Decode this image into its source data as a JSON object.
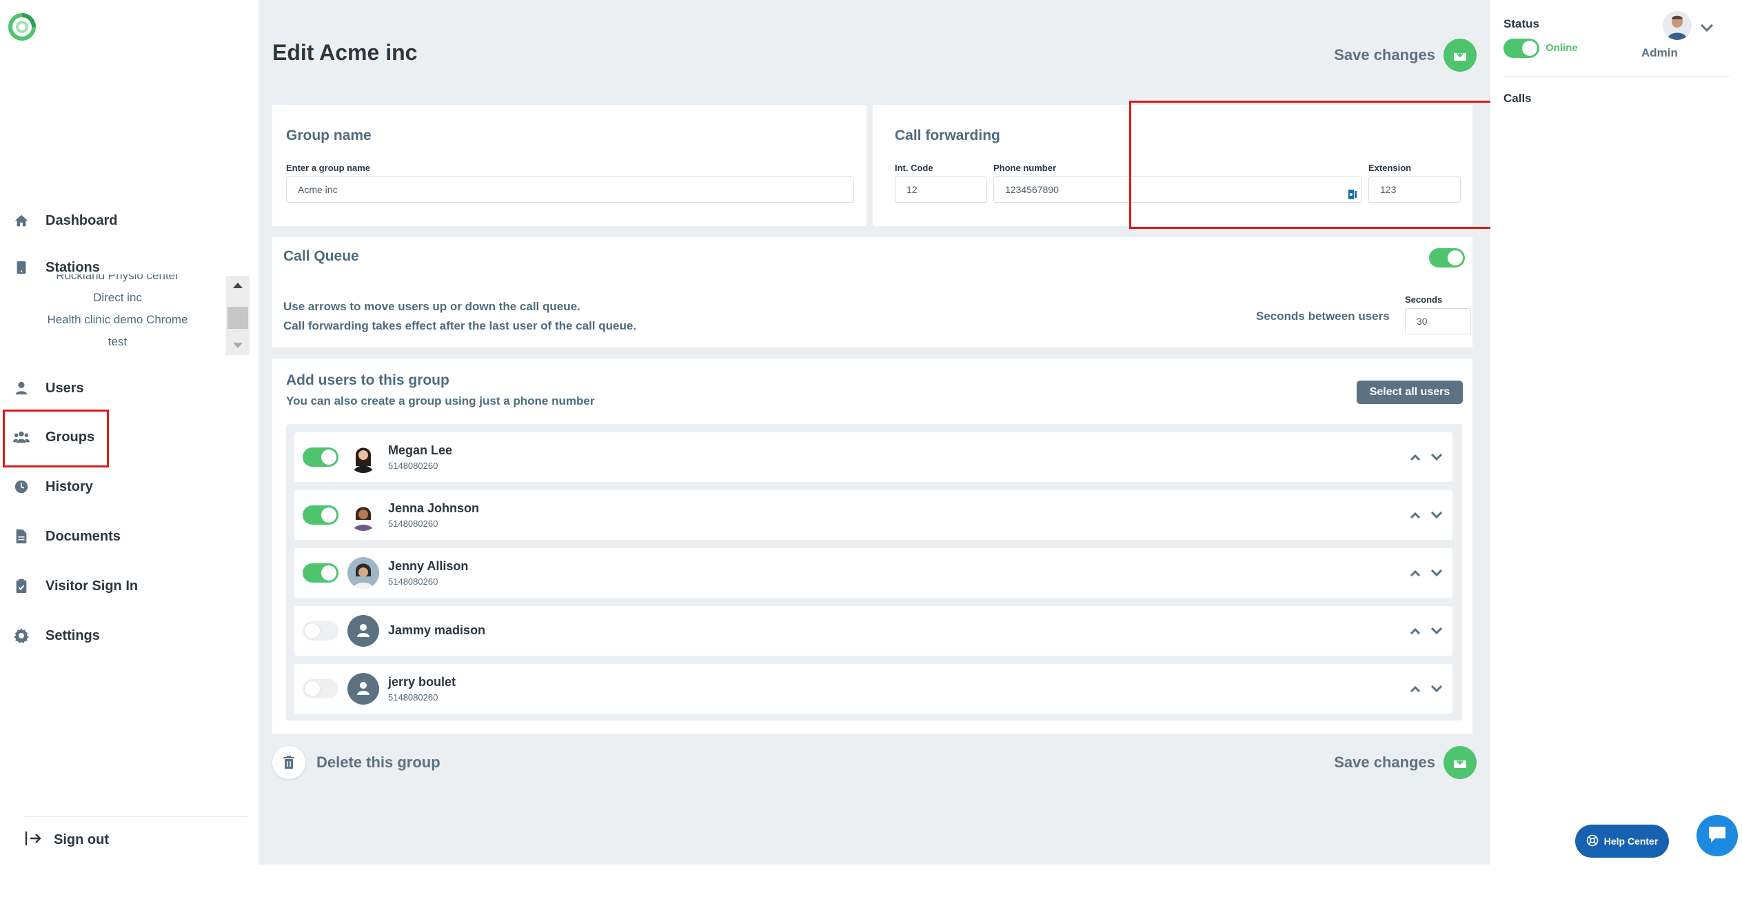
{
  "sidebar": {
    "nav": [
      {
        "id": "dashboard",
        "label": "Dashboard",
        "icon": "home-icon"
      },
      {
        "id": "stations",
        "label": "Stations",
        "icon": "tablet-icon"
      },
      {
        "id": "users",
        "label": "Users",
        "icon": "user-icon"
      },
      {
        "id": "groups",
        "label": "Groups",
        "icon": "users-icon"
      },
      {
        "id": "history",
        "label": "History",
        "icon": "clock-icon"
      },
      {
        "id": "documents",
        "label": "Documents",
        "icon": "document-icon"
      },
      {
        "id": "visitor",
        "label": "Visitor Sign In",
        "icon": "clipboard-check-icon"
      },
      {
        "id": "settings",
        "label": "Settings",
        "icon": "gear-icon"
      }
    ],
    "stations": [
      "Rockland Physio center",
      "Direct inc",
      "Health clinic demo Chrome",
      "test"
    ],
    "sign_out": "Sign out"
  },
  "main": {
    "title": "Edit Acme inc",
    "save_label": "Save changes",
    "group_name": {
      "title": "Group name",
      "field_label": "Enter a group name",
      "value": "Acme inc"
    },
    "call_forwarding": {
      "title": "Call forwarding",
      "int_code_label": "Int. Code",
      "int_code_value": "12",
      "phone_label": "Phone number",
      "phone_value": "1234567890",
      "extension_label": "Extension",
      "extension_value": "123"
    },
    "call_queue": {
      "title": "Call Queue",
      "enabled": true,
      "help_line1": "Use arrows to move users up or down the call queue.",
      "help_line2": "Call forwarding takes effect after the last user of the call queue.",
      "seconds_between_label": "Seconds between users",
      "seconds_label": "Seconds",
      "seconds_value": "30"
    },
    "add_users": {
      "title": "Add users to this group",
      "subtitle": "You can also create a group using just a phone number",
      "select_all": "Select all users",
      "users": [
        {
          "name": "Megan Lee",
          "phone": "5148080260",
          "enabled": true
        },
        {
          "name": "Jenna Johnson",
          "phone": "5148080260",
          "enabled": true
        },
        {
          "name": "Jenny Allison",
          "phone": "5148080260",
          "enabled": true
        },
        {
          "name": "Jammy madison",
          "phone": "",
          "enabled": false
        },
        {
          "name": "jerry boulet",
          "phone": "5148080260",
          "enabled": false
        }
      ]
    },
    "delete_label": "Delete this group"
  },
  "right_panel": {
    "status_label": "Status",
    "online_label": "Online",
    "admin_label": "Admin",
    "calls_label": "Calls"
  },
  "help_center": "Help Center",
  "colors": {
    "accent_green": "#4fc46f",
    "slate": "#5c7282",
    "highlight_red": "#e01919",
    "help_blue": "#1762b0"
  }
}
